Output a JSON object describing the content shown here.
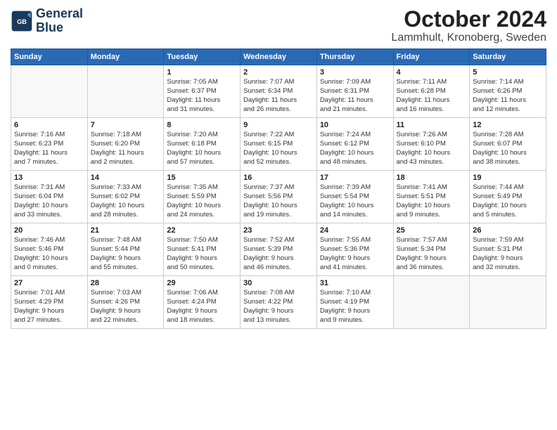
{
  "logo": {
    "line1": "General",
    "line2": "Blue"
  },
  "title": "October 2024",
  "location": "Lammhult, Kronoberg, Sweden",
  "days_of_week": [
    "Sunday",
    "Monday",
    "Tuesday",
    "Wednesday",
    "Thursday",
    "Friday",
    "Saturday"
  ],
  "weeks": [
    [
      {
        "day": "",
        "info": ""
      },
      {
        "day": "",
        "info": ""
      },
      {
        "day": "1",
        "info": "Sunrise: 7:05 AM\nSunset: 6:37 PM\nDaylight: 11 hours\nand 31 minutes."
      },
      {
        "day": "2",
        "info": "Sunrise: 7:07 AM\nSunset: 6:34 PM\nDaylight: 11 hours\nand 26 minutes."
      },
      {
        "day": "3",
        "info": "Sunrise: 7:09 AM\nSunset: 6:31 PM\nDaylight: 11 hours\nand 21 minutes."
      },
      {
        "day": "4",
        "info": "Sunrise: 7:11 AM\nSunset: 6:28 PM\nDaylight: 11 hours\nand 16 minutes."
      },
      {
        "day": "5",
        "info": "Sunrise: 7:14 AM\nSunset: 6:26 PM\nDaylight: 11 hours\nand 12 minutes."
      }
    ],
    [
      {
        "day": "6",
        "info": "Sunrise: 7:16 AM\nSunset: 6:23 PM\nDaylight: 11 hours\nand 7 minutes."
      },
      {
        "day": "7",
        "info": "Sunrise: 7:18 AM\nSunset: 6:20 PM\nDaylight: 11 hours\nand 2 minutes."
      },
      {
        "day": "8",
        "info": "Sunrise: 7:20 AM\nSunset: 6:18 PM\nDaylight: 10 hours\nand 57 minutes."
      },
      {
        "day": "9",
        "info": "Sunrise: 7:22 AM\nSunset: 6:15 PM\nDaylight: 10 hours\nand 52 minutes."
      },
      {
        "day": "10",
        "info": "Sunrise: 7:24 AM\nSunset: 6:12 PM\nDaylight: 10 hours\nand 48 minutes."
      },
      {
        "day": "11",
        "info": "Sunrise: 7:26 AM\nSunset: 6:10 PM\nDaylight: 10 hours\nand 43 minutes."
      },
      {
        "day": "12",
        "info": "Sunrise: 7:28 AM\nSunset: 6:07 PM\nDaylight: 10 hours\nand 38 minutes."
      }
    ],
    [
      {
        "day": "13",
        "info": "Sunrise: 7:31 AM\nSunset: 6:04 PM\nDaylight: 10 hours\nand 33 minutes."
      },
      {
        "day": "14",
        "info": "Sunrise: 7:33 AM\nSunset: 6:02 PM\nDaylight: 10 hours\nand 28 minutes."
      },
      {
        "day": "15",
        "info": "Sunrise: 7:35 AM\nSunset: 5:59 PM\nDaylight: 10 hours\nand 24 minutes."
      },
      {
        "day": "16",
        "info": "Sunrise: 7:37 AM\nSunset: 5:56 PM\nDaylight: 10 hours\nand 19 minutes."
      },
      {
        "day": "17",
        "info": "Sunrise: 7:39 AM\nSunset: 5:54 PM\nDaylight: 10 hours\nand 14 minutes."
      },
      {
        "day": "18",
        "info": "Sunrise: 7:41 AM\nSunset: 5:51 PM\nDaylight: 10 hours\nand 9 minutes."
      },
      {
        "day": "19",
        "info": "Sunrise: 7:44 AM\nSunset: 5:49 PM\nDaylight: 10 hours\nand 5 minutes."
      }
    ],
    [
      {
        "day": "20",
        "info": "Sunrise: 7:46 AM\nSunset: 5:46 PM\nDaylight: 10 hours\nand 0 minutes."
      },
      {
        "day": "21",
        "info": "Sunrise: 7:48 AM\nSunset: 5:44 PM\nDaylight: 9 hours\nand 55 minutes."
      },
      {
        "day": "22",
        "info": "Sunrise: 7:50 AM\nSunset: 5:41 PM\nDaylight: 9 hours\nand 50 minutes."
      },
      {
        "day": "23",
        "info": "Sunrise: 7:52 AM\nSunset: 5:39 PM\nDaylight: 9 hours\nand 46 minutes."
      },
      {
        "day": "24",
        "info": "Sunrise: 7:55 AM\nSunset: 5:36 PM\nDaylight: 9 hours\nand 41 minutes."
      },
      {
        "day": "25",
        "info": "Sunrise: 7:57 AM\nSunset: 5:34 PM\nDaylight: 9 hours\nand 36 minutes."
      },
      {
        "day": "26",
        "info": "Sunrise: 7:59 AM\nSunset: 5:31 PM\nDaylight: 9 hours\nand 32 minutes."
      }
    ],
    [
      {
        "day": "27",
        "info": "Sunrise: 7:01 AM\nSunset: 4:29 PM\nDaylight: 9 hours\nand 27 minutes."
      },
      {
        "day": "28",
        "info": "Sunrise: 7:03 AM\nSunset: 4:26 PM\nDaylight: 9 hours\nand 22 minutes."
      },
      {
        "day": "29",
        "info": "Sunrise: 7:06 AM\nSunset: 4:24 PM\nDaylight: 9 hours\nand 18 minutes."
      },
      {
        "day": "30",
        "info": "Sunrise: 7:08 AM\nSunset: 4:22 PM\nDaylight: 9 hours\nand 13 minutes."
      },
      {
        "day": "31",
        "info": "Sunrise: 7:10 AM\nSunset: 4:19 PM\nDaylight: 9 hours\nand 9 minutes."
      },
      {
        "day": "",
        "info": ""
      },
      {
        "day": "",
        "info": ""
      }
    ]
  ]
}
